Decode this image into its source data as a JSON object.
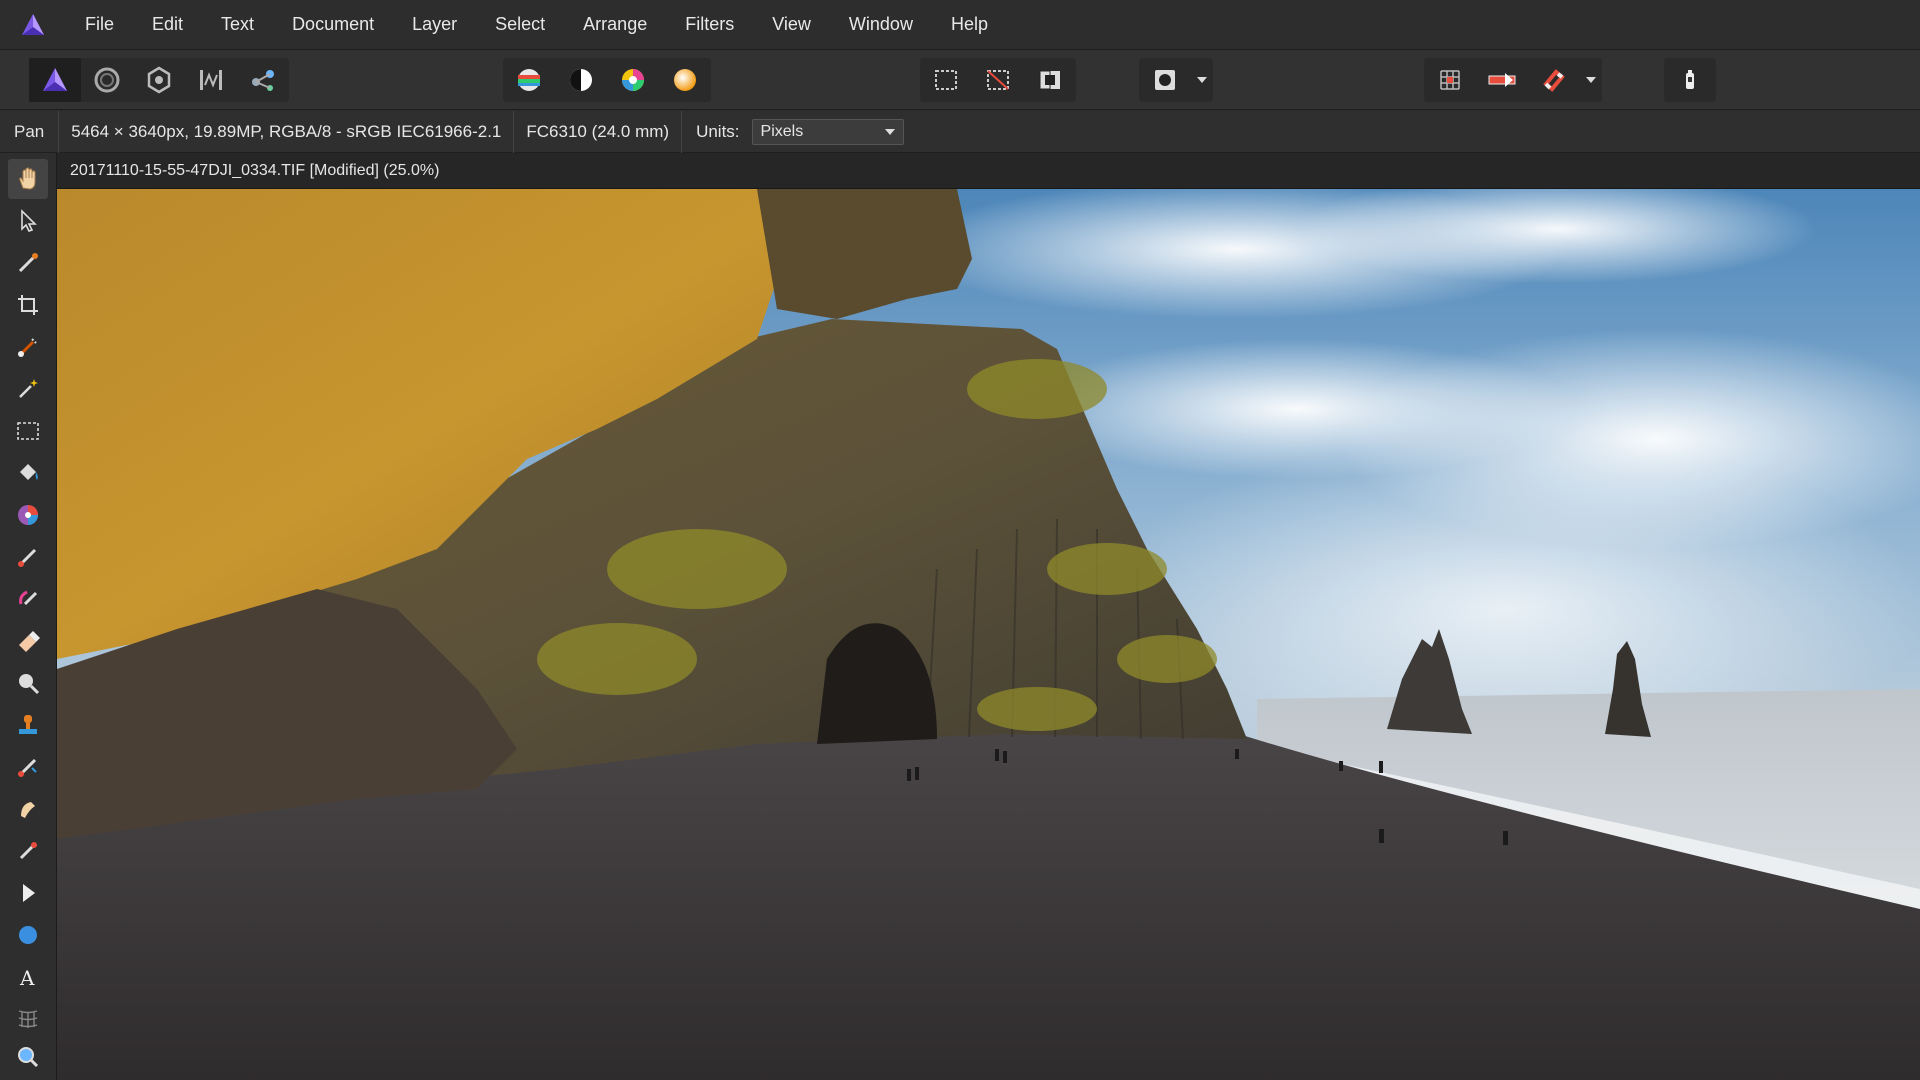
{
  "menu": {
    "logo_icon": "affinity-photo-logo-icon",
    "items": [
      "File",
      "Edit",
      "Text",
      "Document",
      "Layer",
      "Select",
      "Arrange",
      "Filters",
      "View",
      "Window",
      "Help"
    ]
  },
  "toolbar": {
    "personas": [
      "photo-persona-icon",
      "liquify-persona-icon",
      "develop-persona-icon",
      "tone-mapping-persona-icon",
      "export-persona-icon"
    ],
    "adjust": [
      "auto-levels-icon",
      "auto-contrast-icon",
      "auto-colors-icon",
      "auto-white-balance-icon"
    ],
    "selection": [
      "marquee-selection-icon",
      "deselect-icon",
      "invert-selection-icon"
    ],
    "mask": [
      "quick-mask-icon"
    ],
    "snapping": [
      "grid-icon",
      "force-pixel-alignment-icon",
      "snapping-magnet-icon"
    ],
    "assistant": [
      "assistant-icon"
    ]
  },
  "context": {
    "tool_name": "Pan",
    "image_info": "5464 × 3640px, 19.89MP, RGBA/8 - sRGB IEC61966-2.1",
    "camera_info": "FC6310 (24.0 mm)",
    "units_label": "Units:",
    "units_value": "Pixels"
  },
  "document": {
    "tab_title": "20171110-15-55-47DJI_0334.TIF [Modified] (25.0%)"
  },
  "tools": [
    "hand-tool-icon",
    "move-tool-icon",
    "color-picker-tool-icon",
    "crop-tool-icon",
    "selection-brush-tool-icon",
    "magic-wand-tool-icon",
    "rectangular-marquee-tool-icon",
    "flood-fill-tool-icon",
    "gradient-tool-icon",
    "paint-brush-tool-icon",
    "color-replacement-brush-icon",
    "erase-brush-tool-icon",
    "dodge-brush-tool-icon",
    "clone-brush-tool-icon",
    "healing-brush-tool-icon",
    "smudge-brush-tool-icon",
    "red-eye-tool-icon",
    "node-tool-icon",
    "ellipse-tool-icon",
    "artistic-text-tool-icon",
    "mesh-warp-tool-icon",
    "zoom-tool-icon"
  ],
  "colors": {
    "accent": "#8b6cf0",
    "menubar": "#2d2d2d",
    "toolbar": "#323232"
  }
}
